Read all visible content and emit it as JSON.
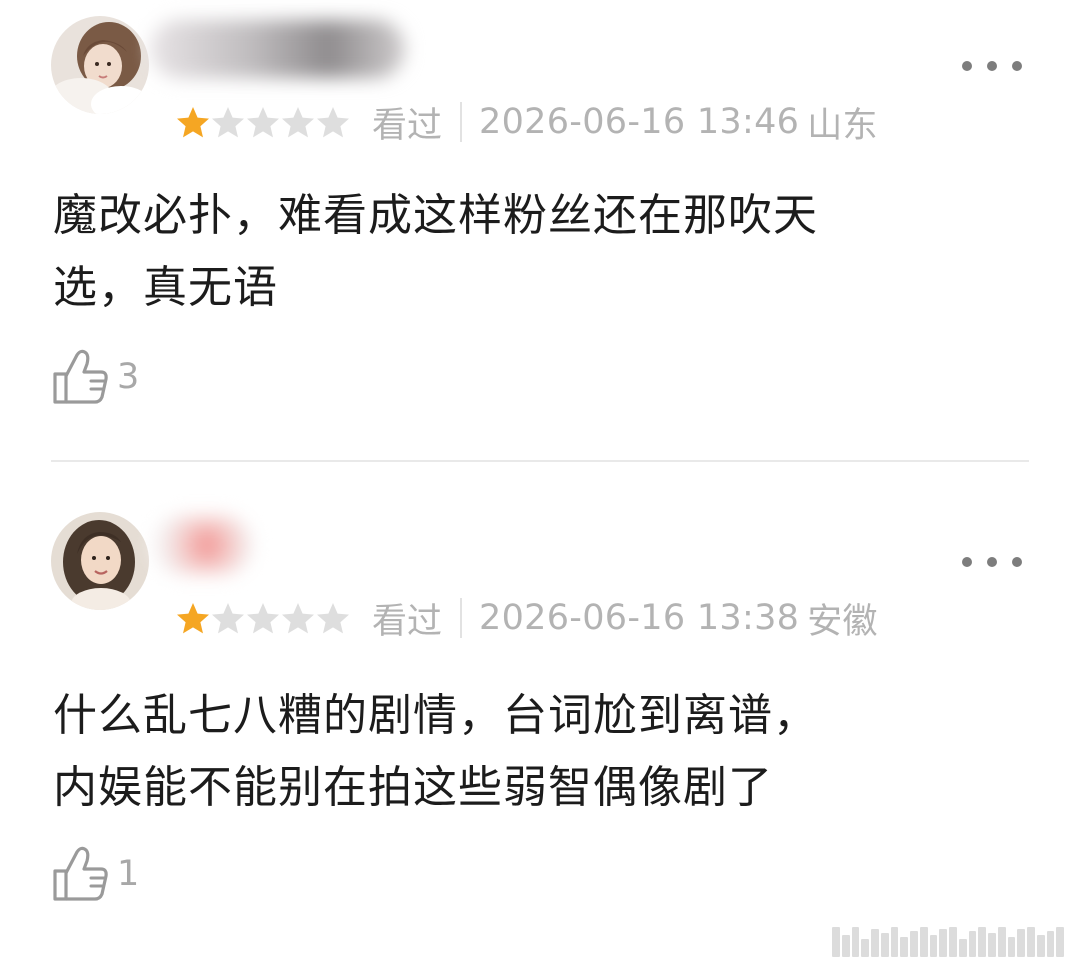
{
  "reviews": [
    {
      "rating": 1,
      "rating_max": 5,
      "status": "看过",
      "datetime": "2026-06-16 13:46",
      "location": "山东",
      "text_line1": "魔改必扑，难看成这样粉丝还在那吹天",
      "text_line2": "选，真无语",
      "likes": "3"
    },
    {
      "rating": 1,
      "rating_max": 5,
      "status": "看过",
      "datetime": "2026-06-16 13:38",
      "location": "安徽",
      "text_line1": "什么乱七八糟的剧情，台词尬到离谱，",
      "text_line2": "内娱能不能别在拍这些弱智偶像剧了",
      "likes": "1"
    }
  ],
  "icons": {
    "more": "more-dots-icon",
    "like": "thumbs-up-icon",
    "star_filled": "star-filled-icon",
    "star_empty": "star-empty-icon"
  },
  "colors": {
    "star_filled": "#f5a623",
    "star_empty": "#dedede",
    "meta_text": "#b3b3b3",
    "body_text": "#1c1c1c"
  }
}
